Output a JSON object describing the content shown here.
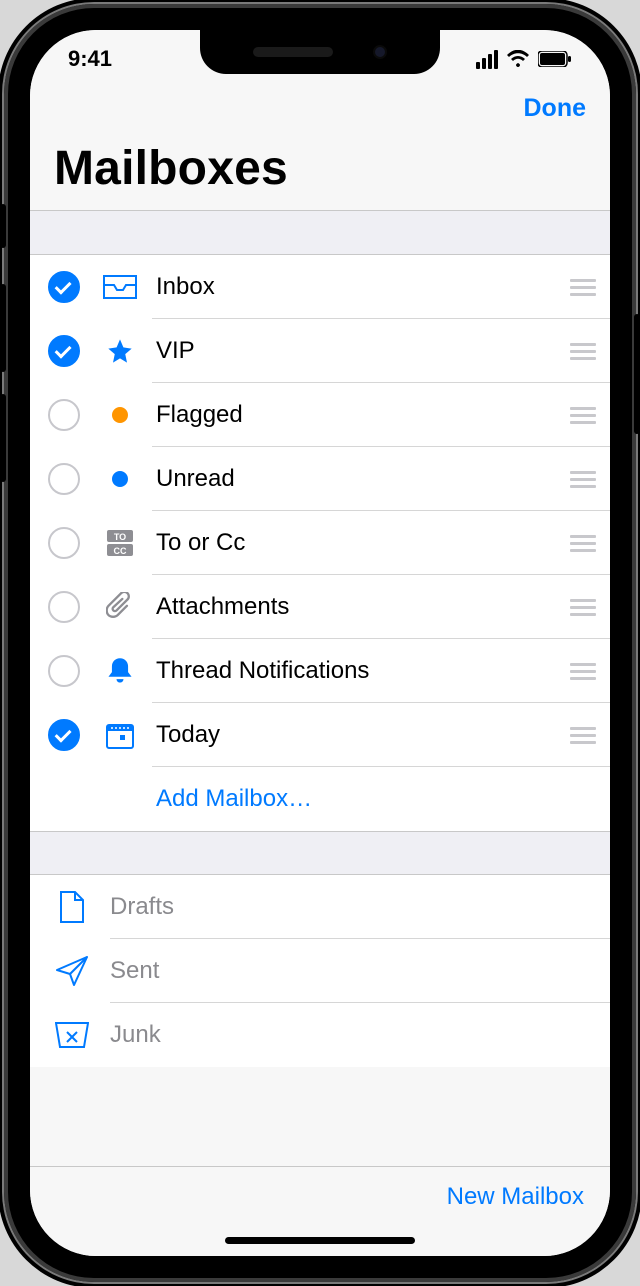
{
  "status": {
    "time": "9:41"
  },
  "header": {
    "done": "Done",
    "title": "Mailboxes"
  },
  "smart": {
    "items": [
      {
        "label": "Inbox",
        "checked": true,
        "icon": "inbox"
      },
      {
        "label": "VIP",
        "checked": true,
        "icon": "star"
      },
      {
        "label": "Flagged",
        "checked": false,
        "icon": "flag-orange"
      },
      {
        "label": "Unread",
        "checked": false,
        "icon": "flag-blue"
      },
      {
        "label": "To or Cc",
        "checked": false,
        "icon": "to-cc"
      },
      {
        "label": "Attachments",
        "checked": false,
        "icon": "paperclip"
      },
      {
        "label": "Thread Notifications",
        "checked": false,
        "icon": "bell"
      },
      {
        "label": "Today",
        "checked": true,
        "icon": "calendar"
      }
    ],
    "add_label": "Add Mailbox…"
  },
  "account": {
    "items": [
      {
        "label": "Drafts",
        "icon": "doc"
      },
      {
        "label": "Sent",
        "icon": "plane"
      },
      {
        "label": "Junk",
        "icon": "junk"
      }
    ]
  },
  "toolbar": {
    "new_mailbox": "New Mailbox"
  }
}
